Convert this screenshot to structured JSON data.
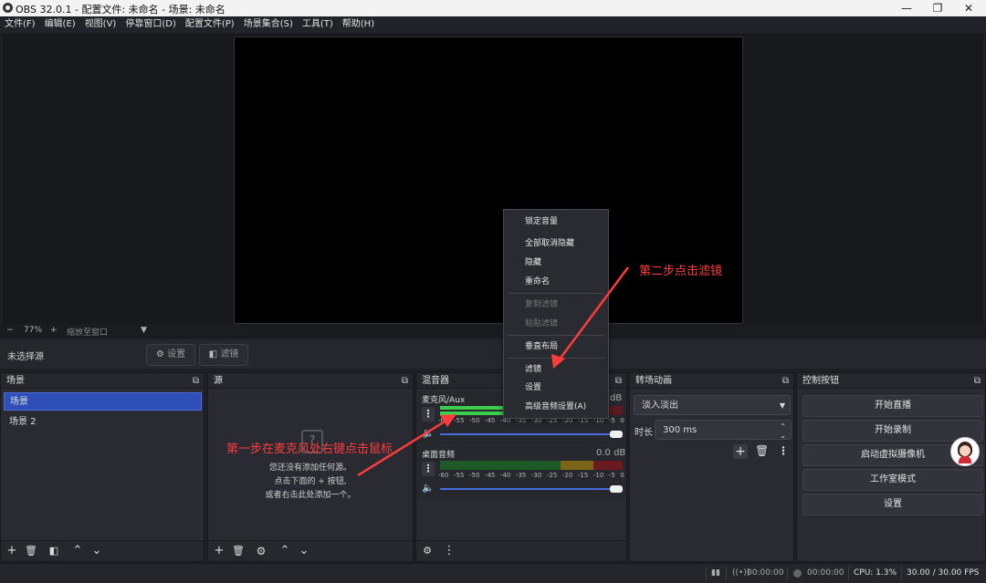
{
  "window": {
    "title": "OBS 32.0.1 - 配置文件: 未命名 - 场景: 未命名"
  },
  "menu": [
    "文件(F)",
    "编辑(E)",
    "视图(V)",
    "停靠窗口(D)",
    "配置文件(P)",
    "场景集合(S)",
    "工具(T)",
    "帮助(H)"
  ],
  "zoom": {
    "minus": "−",
    "percent": "77%",
    "plus": "+",
    "mode": "缩放至窗口"
  },
  "source_bar": {
    "no_source": "未选择源",
    "settings": "设置",
    "filters": "滤镜"
  },
  "scenes": {
    "title": "场景",
    "items": [
      "场景",
      "场景 2"
    ]
  },
  "sources": {
    "title": "源",
    "empty_line1": "您还没有添加任何源。",
    "empty_line2": "点击下面的 + 按钮,",
    "empty_line3": "或者右击此处添加一个。"
  },
  "mixer": {
    "title": "混音器",
    "channels": [
      {
        "name": "麦克风/Aux",
        "db": "dB",
        "level": 0.55
      },
      {
        "name": "桌面音频",
        "db": "0.0 dB",
        "level": 0.0
      }
    ],
    "ticks": [
      "-60",
      "-55",
      "-50",
      "-45",
      "-40",
      "-35",
      "-30",
      "-25",
      "-20",
      "-15",
      "-10",
      "-5",
      "0"
    ]
  },
  "transitions": {
    "title": "转场动画",
    "selected": "淡入淡出",
    "duration_label": "时长",
    "duration": "300 ms"
  },
  "controls": {
    "title": "控制按钮",
    "buttons": [
      "开始直播",
      "开始录制",
      "启动虚拟摄像机",
      "工作室模式",
      "设置"
    ]
  },
  "context_menu": {
    "items": [
      "锁定音量",
      "全部取消隐藏",
      "隐藏",
      "重命名",
      "复制滤镜",
      "粘贴滤镜",
      "垂直布局",
      "滤镜",
      "设置",
      "高级音频设置(A)"
    ]
  },
  "annotations": {
    "step1": "第一步在麦克风处右键点击鼠标",
    "step2": "第二步点击滤镜"
  },
  "status": {
    "stream_time": "00:00:00",
    "rec_time": "00:00:00",
    "cpu": "CPU: 1.3%",
    "fps": "30.00 / 30.00 FPS"
  },
  "colors": {
    "accent": "#2e4fb8",
    "annotation": "#ff3b3b",
    "meter_green": "#3ccf4e",
    "meter_yellow": "#c9a227",
    "meter_red": "#b02a2a"
  }
}
